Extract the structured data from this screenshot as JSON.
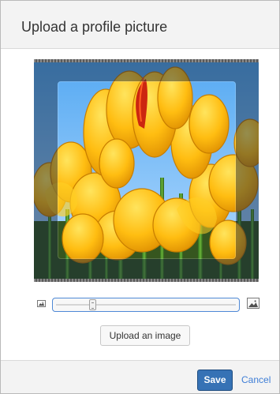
{
  "dialog": {
    "title": "Upload a profile picture"
  },
  "image_editor": {
    "zoom_out_icon": "small-image-icon",
    "zoom_in_icon": "large-image-icon",
    "zoom_level": 0.2
  },
  "actions": {
    "upload_label": "Upload an image",
    "save_label": "Save",
    "cancel_label": "Cancel"
  },
  "colors": {
    "primary": "#3672b5",
    "link": "#3f7ed6"
  }
}
